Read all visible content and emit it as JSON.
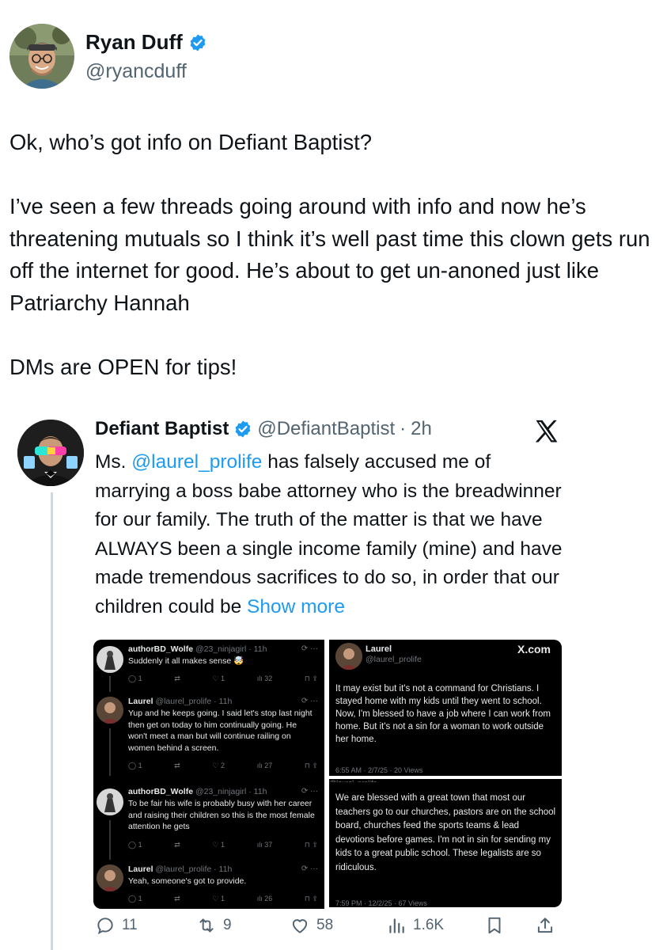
{
  "author": {
    "name": "Ryan Duff",
    "handle": "@ryancduff"
  },
  "tweet": {
    "paragraphs": [
      "Ok, who’s got info on Defiant Baptist?",
      "I’ve seen a few threads going around with info and now he’s threatening mutuals so I think it’s well past time this clown gets run off the internet for good. He’s about to get un-anoned just like Patriarchy Hannah",
      "DMs are OPEN for tips!"
    ]
  },
  "quoted": {
    "name": "Defiant Baptist",
    "handle": "@DefiantBaptist",
    "separator": " · ",
    "time": "2h",
    "text_prefix": "Ms. ",
    "mention": "@laurel_prolife",
    "text_rest": " has falsely accused me of marrying a boss babe attorney who is the breadwinner for our family. The truth of the matter is that we have ALWAYS been a single income family (mine) and have made tremendous sacrifices to do so, in order that our children could be ",
    "show_more": "Show more"
  },
  "screenshot_left": {
    "posts": [
      {
        "name": "authorBD_Wolfe",
        "handle": "@23_ninjagirl · 11h",
        "body": "Suddenly it all makes sense 🤯",
        "replies": "1",
        "reposts": "",
        "likes": "1",
        "views": "32"
      },
      {
        "name": "Laurel",
        "handle": "@laurel_prolife · 11h",
        "body": "Yup and he keeps going. I said let's stop last night then get on today to him continually going. He won't meet a man but will continue railing on women behind a screen.",
        "replies": "1",
        "reposts": "",
        "likes": "2",
        "views": "27"
      },
      {
        "name": "authorBD_Wolfe",
        "handle": "@23_ninjagirl · 11h",
        "body": "To be fair his wife is probably busy with her career and raising their children so this is the most female attention he gets",
        "replies": "1",
        "reposts": "",
        "likes": "1",
        "views": "37"
      },
      {
        "name": "Laurel",
        "handle": "@laurel_prolife · 11h",
        "body": "Yeah, someone's got to provide.",
        "replies": "1",
        "reposts": "",
        "likes": "1",
        "views": "26"
      }
    ]
  },
  "screenshot_right_top": {
    "name": "Laurel",
    "handle": "@laurel_prolife",
    "brand": "X.com",
    "body": "It may exist but it's not a command for Christians. I stayed home with my kids until they went to school. Now, I'm blessed to have a job where I can work from home. But it's not a sin for a woman to work outside her home.",
    "meta": "6:55 AM · 2/7/25 · 20 Views"
  },
  "screenshot_right_bottom": {
    "top_cut": "@laurel_prolife",
    "body": "We are blessed with a great town that most our teachers go to our churches, pastors are on the school board, churches feed the sports teams & lead devotions before games. I'm not in sin for sending my kids to a great public school. These legalists are so ridiculous.",
    "meta": "7:59 PM · 12/2/25 · 67 Views"
  },
  "actions": {
    "replies": "11",
    "reposts": "9",
    "likes": "58",
    "views": "1.6K"
  },
  "icons": [
    "verified-badge-icon",
    "x-logo-icon",
    "reply-icon",
    "repost-icon",
    "like-icon",
    "views-icon",
    "bookmark-icon",
    "share-icon"
  ],
  "colors": {
    "link": "#1d9bf0",
    "verified": "#1d9bf0",
    "muted": "#536471",
    "text": "#0f1419"
  }
}
